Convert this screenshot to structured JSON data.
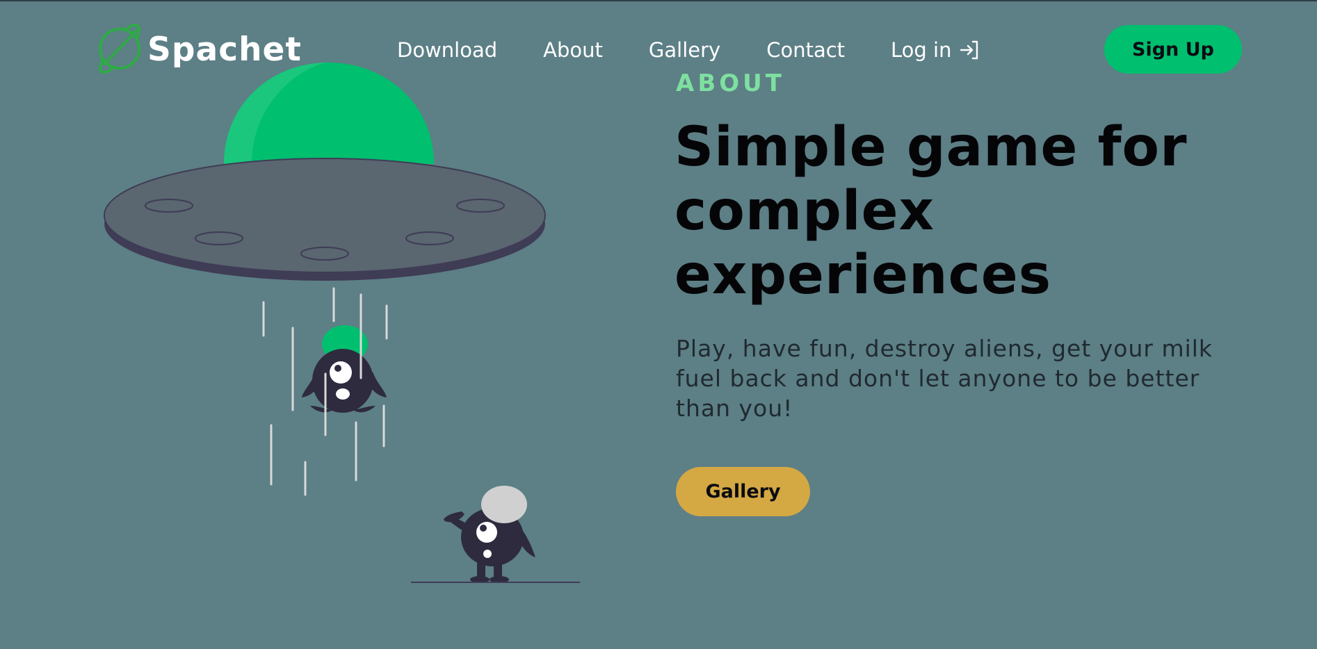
{
  "brand": {
    "name": "Spachet",
    "logo_icon": "planet-icon"
  },
  "nav": {
    "items": [
      {
        "label": "Download"
      },
      {
        "label": "About"
      },
      {
        "label": "Gallery"
      },
      {
        "label": "Contact"
      }
    ],
    "login_label": "Log in",
    "login_icon": "login-arrow-icon",
    "signup_label": "Sign Up"
  },
  "hero": {
    "eyebrow": "ABOUT",
    "title": "Simple game for complex experiences",
    "description": "Play, have fun, destroy aliens, get your milk fuel back and don't let anyone to be better than you!",
    "cta_label": "Gallery"
  },
  "illustration": {
    "subject": "ufo-abducting-alien-icon"
  },
  "colors": {
    "background": "#5d7f86",
    "accent_green": "#00bf6f",
    "eyebrow_green": "#7ee0a0",
    "gallery_yellow": "#d4a843",
    "alien_dark": "#2e2b3f",
    "ufo_disc": "#5a6670",
    "ufo_rim": "#3f3c56"
  }
}
